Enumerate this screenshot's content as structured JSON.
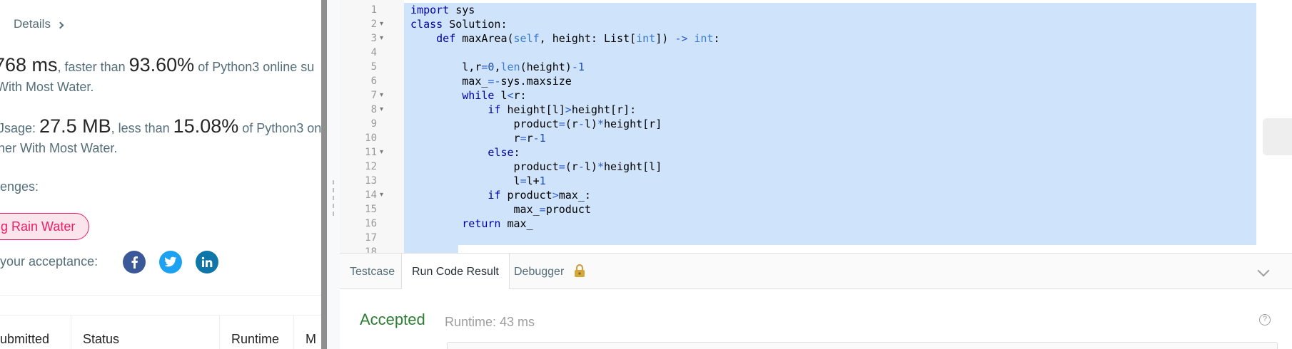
{
  "left": {
    "details_label": "Details",
    "runtime_value": "768 ms",
    "runtime_mid": ", faster than ",
    "runtime_percent": "93.60%",
    "runtime_tail": " of Python3 online su",
    "runtime_line2": " With Most Water.",
    "memory_prefix": "Jsage: ",
    "memory_value": "27.5 MB",
    "memory_mid": ", less than ",
    "memory_percent": "15.08%",
    "memory_tail": " of Python3 on",
    "memory_line2": "ner With Most Water.",
    "challenges_label": "enges:",
    "challenge_tag": "g Rain Water",
    "share_label": "your acceptance:",
    "social": [
      "facebook-icon",
      "twitter-icon",
      "linkedin-icon"
    ],
    "table_headers": [
      "ubmitted",
      "Status",
      "Runtime",
      "M"
    ]
  },
  "editor": {
    "line_numbers": [
      "1",
      "2",
      "3",
      "4",
      "5",
      "6",
      "7",
      "8",
      "9",
      "10",
      "11",
      "12",
      "13",
      "14",
      "15",
      "16",
      "17",
      "18"
    ],
    "folds": [
      "",
      "▾",
      "▾",
      "",
      "",
      "",
      "▾",
      "▾",
      "",
      "",
      "▾",
      "",
      "",
      "▾",
      "",
      "",
      "",
      ""
    ],
    "lines": [
      "import sys",
      "class Solution:",
      "    def maxArea(self, height: List[int]) -> int:",
      "",
      "        l,r=0,len(height)-1",
      "        max_=-sys.maxsize",
      "        while l<r:",
      "            if height[l]>height[r]:",
      "                product=(r-l)*height[r]",
      "                r=r-1",
      "            else:",
      "                product=(r-l)*height[l]",
      "                l=l+1",
      "            if product>max_:",
      "                max_=product",
      "        return max_",
      "",
      ""
    ]
  },
  "tabs": {
    "testcase": "Testcase",
    "run_result": "Run Code Result",
    "debugger": "Debugger"
  },
  "result": {
    "status": "Accepted",
    "runtime": "Runtime: 43 ms",
    "help": "?"
  },
  "colors": {
    "accepted_green": "#2e7d32",
    "tag_pink": "#e91e63",
    "selection_blue": "#cfe3fb",
    "facebook": "#3b5998",
    "twitter": "#1da1f2",
    "linkedin": "#0e76a8"
  }
}
